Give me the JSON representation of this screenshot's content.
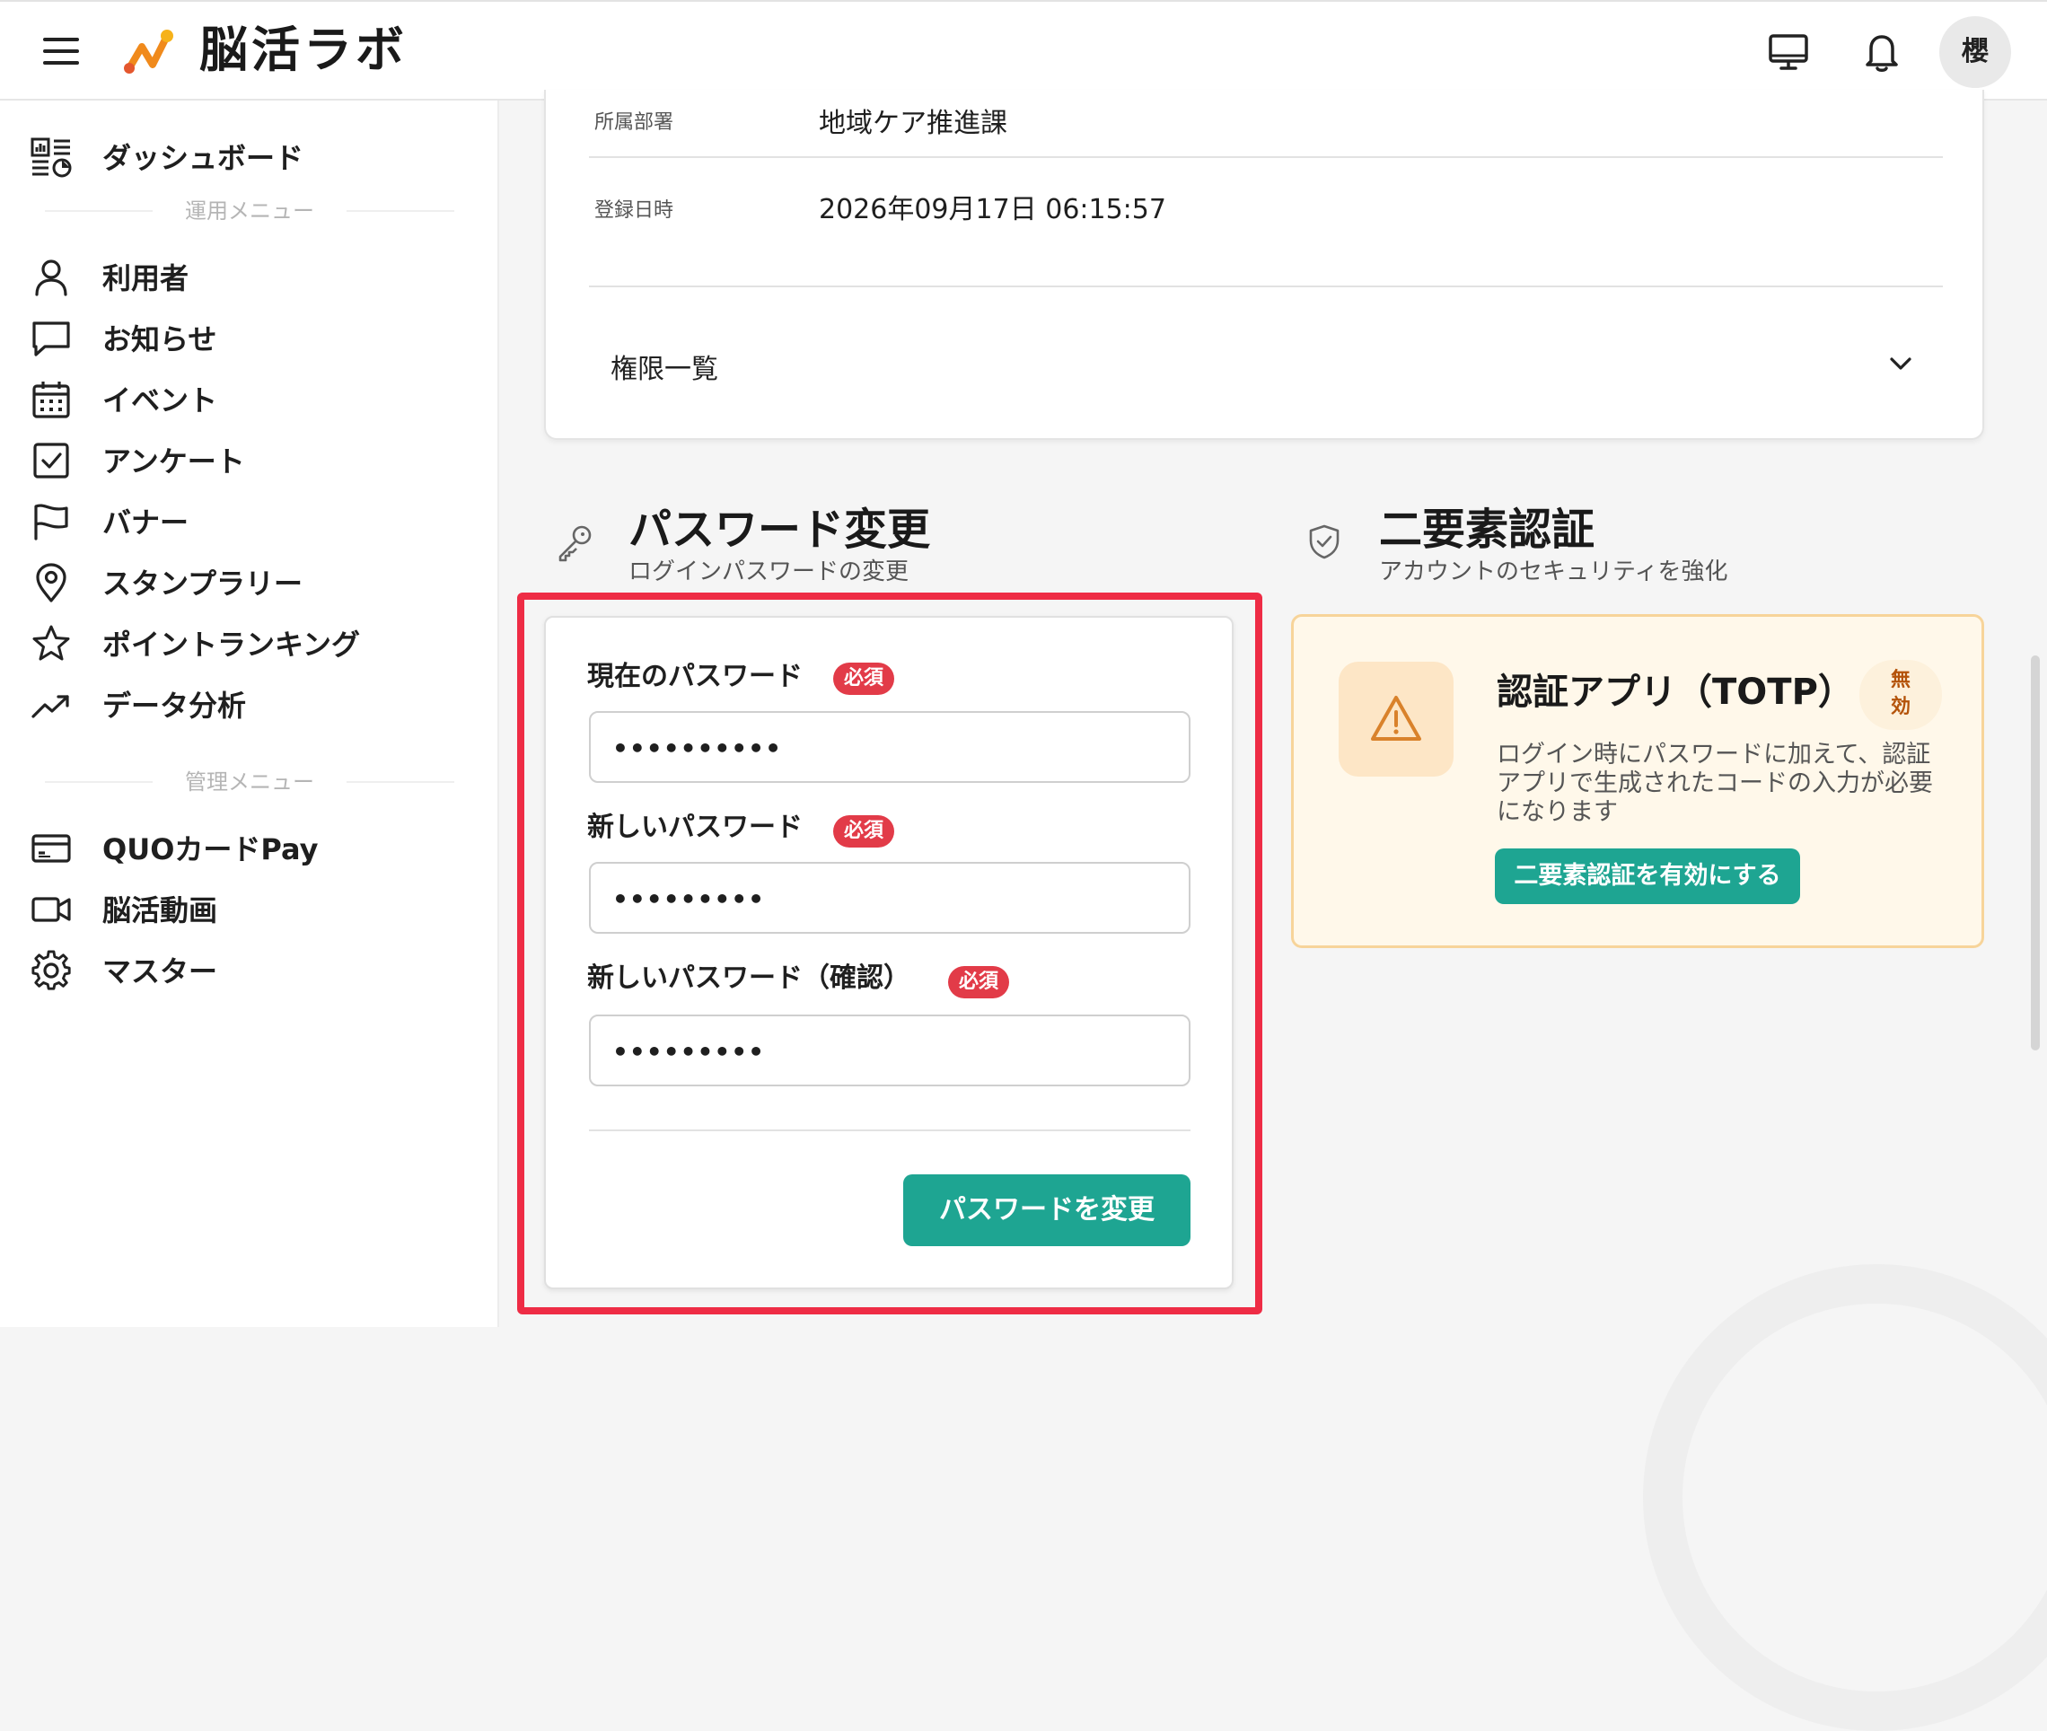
{
  "app": {
    "logo_text": "脳活ラボ",
    "avatar_initial": "櫻",
    "accent_color": "#1ea592",
    "required_color": "#e23b48",
    "highlight_color": "#ee2c45"
  },
  "header": {
    "icons": [
      "menu-icon",
      "monitor-icon",
      "bell-icon"
    ]
  },
  "sidebar": {
    "dashboard": {
      "label": "ダッシュボード",
      "icon": "dashboard-icon"
    },
    "operations_header": "運用メニュー",
    "operations": [
      {
        "label": "利用者",
        "icon": "user-icon"
      },
      {
        "label": "お知らせ",
        "icon": "message-icon"
      },
      {
        "label": "イベント",
        "icon": "calendar-icon"
      },
      {
        "label": "アンケート",
        "icon": "checkbox-icon"
      },
      {
        "label": "バナー",
        "icon": "flag-icon"
      },
      {
        "label": "スタンプラリー",
        "icon": "map-pin-icon"
      },
      {
        "label": "ポイントランキング",
        "icon": "star-icon"
      },
      {
        "label": "データ分析",
        "icon": "trending-up-icon"
      }
    ],
    "admin_header": "管理メニュー",
    "admin": [
      {
        "label": "QUOカードPay",
        "icon": "credit-card-icon"
      },
      {
        "label": "脳活動画",
        "icon": "video-icon"
      },
      {
        "label": "マスター",
        "icon": "gear-icon"
      }
    ]
  },
  "profile": {
    "department_label": "所属部署",
    "department_value": "地域ケア推進課",
    "registered_label": "登録日時",
    "registered_value": "2026年09月17日 06:15:57",
    "permissions_label": "権限一覧"
  },
  "password": {
    "title": "パスワード変更",
    "subtitle": "ログインパスワードの変更",
    "required_badge": "必須",
    "current_label": "現在のパスワード",
    "current_value": "••••••••••",
    "new_label": "新しいパスワード",
    "new_value": "•••••••••",
    "confirm_label": "新しいパスワード（確認）",
    "confirm_value": "•••••••••",
    "submit_label": "パスワードを変更"
  },
  "two_factor": {
    "title": "二要素認証",
    "subtitle": "アカウントのセキュリティを強化",
    "app_title": "認証アプリ（TOTP）",
    "status_badge": "無効",
    "description": "ログイン時にパスワードに加えて、認証アプリで生成されたコードの入力が必要になります",
    "enable_label": "二要素認証を有効にする"
  }
}
